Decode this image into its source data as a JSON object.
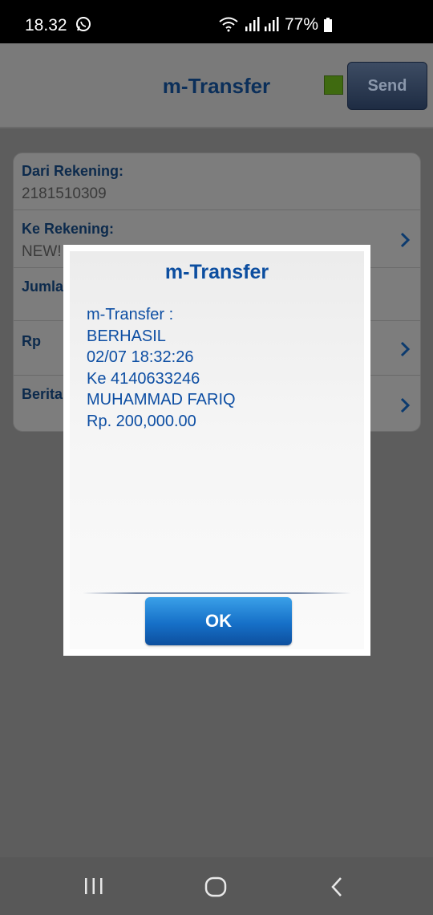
{
  "status_bar": {
    "time": "18.32",
    "battery": "77%",
    "icons": [
      "whatsapp-icon",
      "wifi-icon",
      "signal-icon",
      "signal-icon",
      "battery-icon"
    ]
  },
  "header": {
    "title": "m-Transfer",
    "send_label": "Send",
    "indicator_color": "#3f6a10"
  },
  "form": {
    "dari_label": "Dari Rekening:",
    "dari_value": "2181510309",
    "ke_label": "Ke Rekening:",
    "ke_value": "NEW!",
    "jumlah_label": "Jumla",
    "rp_label": "Rp",
    "berita_label": "Berita"
  },
  "dialog": {
    "title": "m-Transfer",
    "lines": [
      "m-Transfer :",
      "BERHASIL",
      "02/07 18:32:26",
      "Ke 4140633246",
      "MUHAMMAD FARIQ",
      "Rp. 200,000.00"
    ],
    "ok_label": "OK"
  },
  "colors": {
    "accent": "#0c4ea0",
    "ok_button": "#1670c8"
  },
  "nav": {
    "icons": [
      "recents-icon",
      "home-icon",
      "back-icon"
    ]
  }
}
